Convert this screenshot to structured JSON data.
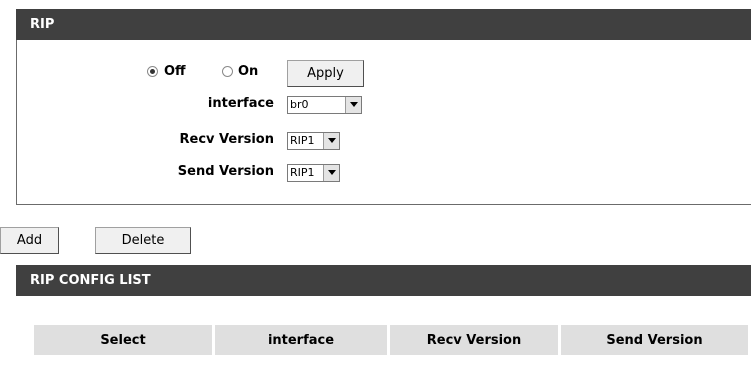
{
  "rip": {
    "title": "RIP",
    "off_label": "Off",
    "on_label": "On",
    "selected": "Off",
    "apply_label": "Apply",
    "interface_label": "interface",
    "interface_value": "br0",
    "recv_label": "Recv Version",
    "recv_value": "RIP1",
    "send_label": "Send Version",
    "send_value": "RIP1"
  },
  "actions": {
    "add_label": "Add",
    "delete_label": "Delete"
  },
  "config_list": {
    "title": "RIP CONFIG LIST",
    "columns": [
      "Select",
      "interface",
      "Recv Version",
      "Send Version"
    ]
  }
}
